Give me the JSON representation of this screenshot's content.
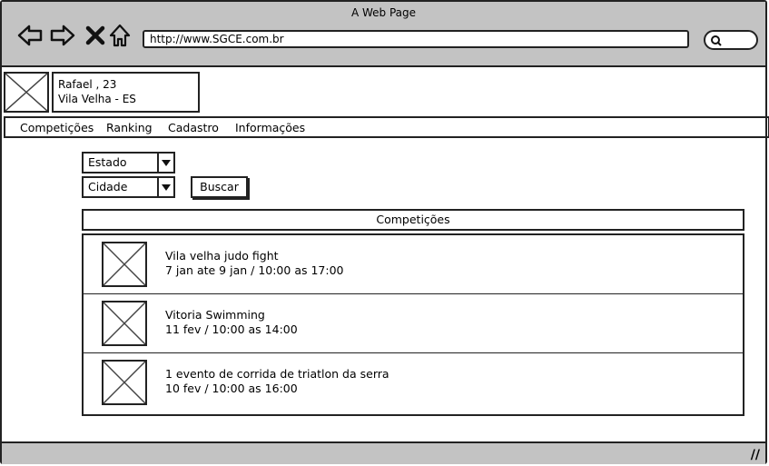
{
  "browser": {
    "title": "A Web Page",
    "url": "http://www.SGCE.com.br",
    "icons": [
      "back-icon",
      "forward-icon",
      "close-icon",
      "home-icon",
      "search-icon"
    ]
  },
  "profile": {
    "name_age": "Rafael , 23",
    "location": "Vila Velha - ES"
  },
  "menu": {
    "items": [
      "Competições",
      "Ranking",
      "Cadastro",
      "Informações"
    ]
  },
  "filters": {
    "estado": "Estado",
    "cidade": "Cidade",
    "search_label": "Buscar"
  },
  "competitions": {
    "header": "Competições",
    "items": [
      {
        "title": "Vila velha judo fight",
        "schedule": "7 jan ate 9 jan / 10:00 as 17:00"
      },
      {
        "title": "Vitoria Swimming",
        "schedule": "11 fev / 10:00 as 14:00"
      },
      {
        "title": "1 evento de corrida de triatlon da serra",
        "schedule": "10 fev / 10:00 as 16:00"
      }
    ]
  }
}
